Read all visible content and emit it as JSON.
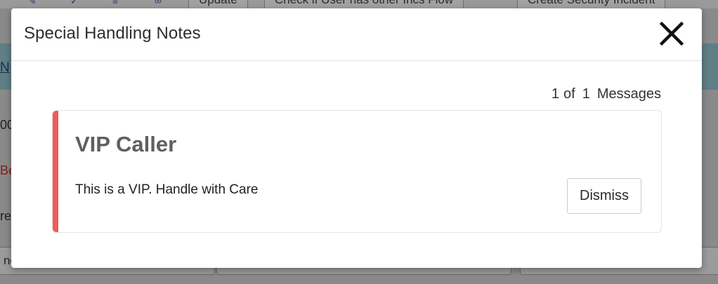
{
  "background": {
    "toolbar_buttons": [
      "Update",
      "Check if User has other Incs Flow",
      "Create Security Incident"
    ],
    "band_link": "N",
    "fragments": [
      "00",
      "Be",
      "re",
      "ng"
    ]
  },
  "modal": {
    "title": "Special Handling Notes",
    "close_icon": "close-icon",
    "counter": {
      "current": "1",
      "of_label": "of",
      "total": "1",
      "suffix": "Messages"
    },
    "message": {
      "title": "VIP Caller",
      "body": "This is a VIP. Handle with Care",
      "accent_color": "#f15a5a",
      "dismiss_label": "Dismiss"
    }
  }
}
